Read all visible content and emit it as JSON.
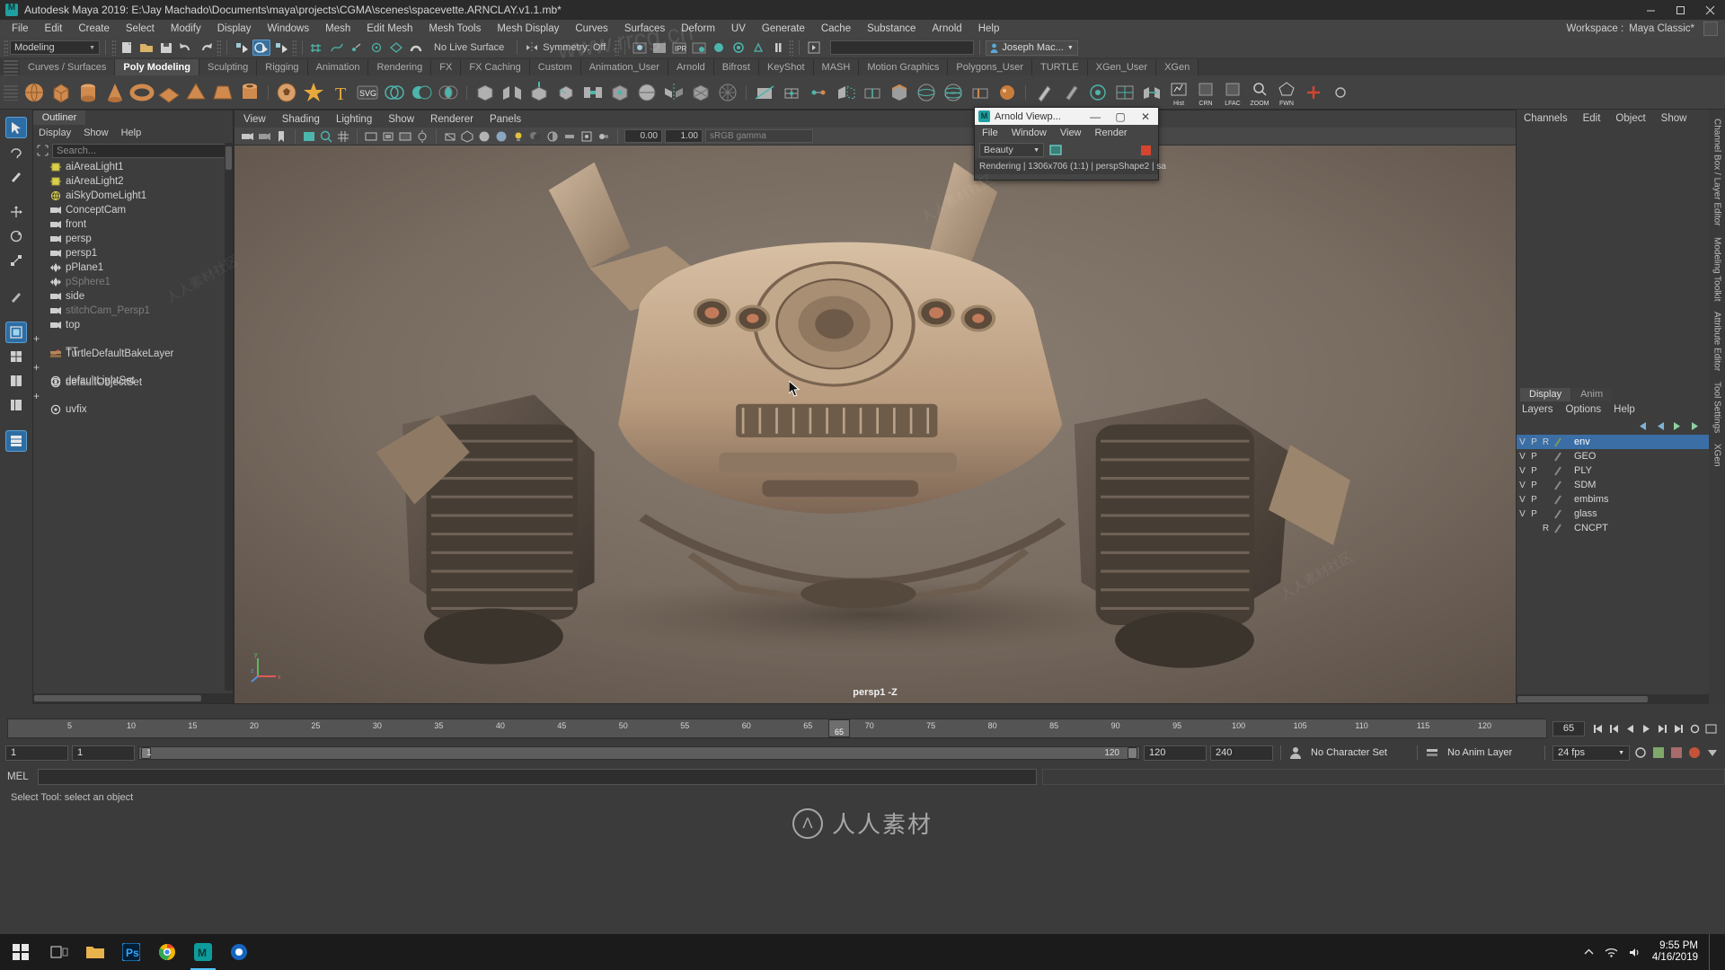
{
  "window": {
    "title": "Autodesk Maya 2019: E:\\Jay Machado\\Documents\\maya\\projects\\CGMA\\scenes\\spacevette.ARNCLAY.v1.1.mb*",
    "minimize": "—",
    "maximize": "▢",
    "close": "✕"
  },
  "menubar": {
    "items": [
      {
        "label": "File"
      },
      {
        "label": "Edit"
      },
      {
        "label": "Create"
      },
      {
        "label": "Select"
      },
      {
        "label": "Modify"
      },
      {
        "label": "Display"
      },
      {
        "label": "Windows"
      },
      {
        "label": "Mesh"
      },
      {
        "label": "Edit Mesh"
      },
      {
        "label": "Mesh Tools"
      },
      {
        "label": "Mesh Display"
      },
      {
        "label": "Curves"
      },
      {
        "label": "Surfaces"
      },
      {
        "label": "Deform"
      },
      {
        "label": "UV"
      },
      {
        "label": "Generate"
      },
      {
        "label": "Cache"
      },
      {
        "label": "Substance"
      },
      {
        "label": "Arnold"
      },
      {
        "label": "Help"
      }
    ],
    "workspace_label": "Workspace :",
    "workspace_value": "Maya Classic*"
  },
  "statusbar": {
    "menu_set": "Modeling",
    "live_surface": "No Live Surface",
    "symmetry": "Symmetry: Off",
    "search_value": "",
    "user": "Joseph Mac...",
    "arrow": "▼"
  },
  "shelf": {
    "tabs": [
      {
        "label": "Curves / Surfaces",
        "active": false
      },
      {
        "label": "Poly Modeling",
        "active": true
      },
      {
        "label": "Sculpting",
        "active": false
      },
      {
        "label": "Rigging",
        "active": false
      },
      {
        "label": "Animation",
        "active": false
      },
      {
        "label": "Rendering",
        "active": false
      },
      {
        "label": "FX",
        "active": false
      },
      {
        "label": "FX Caching",
        "active": false
      },
      {
        "label": "Custom",
        "active": false
      },
      {
        "label": "Animation_User",
        "active": false
      },
      {
        "label": "Arnold",
        "active": false
      },
      {
        "label": "Bifrost",
        "active": false
      },
      {
        "label": "KeyShot",
        "active": false
      },
      {
        "label": "MASH",
        "active": false
      },
      {
        "label": "Motion Graphics",
        "active": false
      },
      {
        "label": "Polygons_User",
        "active": false
      },
      {
        "label": "TURTLE",
        "active": false
      },
      {
        "label": "XGen_User",
        "active": false
      },
      {
        "label": "XGen",
        "active": false
      }
    ],
    "right_icon_labels": [
      "Hist",
      "CRN",
      "LFAC",
      "ZOOM",
      "FWN"
    ]
  },
  "outliner": {
    "tab": "Outliner",
    "menus": [
      "Display",
      "Show",
      "Help"
    ],
    "search_placeholder": "Search...",
    "items": [
      {
        "label": "aiAreaLight1",
        "icon": "area-light-icon",
        "dim": false,
        "expand": false
      },
      {
        "label": "aiAreaLight2",
        "icon": "area-light-icon",
        "dim": false,
        "expand": false
      },
      {
        "label": "aiSkyDomeLight1",
        "icon": "skydome-light-icon",
        "dim": false,
        "expand": false
      },
      {
        "label": "ConceptCam",
        "icon": "camera-icon",
        "dim": false,
        "expand": false
      },
      {
        "label": "front",
        "icon": "camera-icon",
        "dim": false,
        "expand": false
      },
      {
        "label": "persp",
        "icon": "camera-icon",
        "dim": false,
        "expand": false
      },
      {
        "label": "persp1",
        "icon": "camera-icon",
        "dim": false,
        "expand": false
      },
      {
        "label": "pPlane1",
        "icon": "mesh-icon",
        "dim": false,
        "expand": false
      },
      {
        "label": "pSphere1",
        "icon": "mesh-icon",
        "dim": true,
        "expand": false
      },
      {
        "label": "side",
        "icon": "camera-icon",
        "dim": false,
        "expand": false
      },
      {
        "label": "stitchCam_Persp1",
        "icon": "camera-icon",
        "dim": true,
        "expand": false
      },
      {
        "label": "top",
        "icon": "camera-icon",
        "dim": false,
        "expand": false
      },
      {
        "label": "TT",
        "icon": "turtle-icon",
        "dim": false,
        "expand": true
      },
      {
        "label": "TurtleDefaultBakeLayer",
        "icon": "bakelayer-icon",
        "dim": false,
        "expand": false
      },
      {
        "label": "defaultLightSet",
        "icon": "set-icon",
        "dim": false,
        "expand": true
      },
      {
        "label": "defaultObjectSet",
        "icon": "set-icon",
        "dim": false,
        "expand": false
      },
      {
        "label": "uvfix",
        "icon": "set-icon",
        "dim": false,
        "expand": true
      }
    ]
  },
  "viewport": {
    "menus": [
      "View",
      "Shading",
      "Lighting",
      "Show",
      "Renderer",
      "Panels"
    ],
    "exposure": "0.00",
    "gamma": "1.00",
    "color_space": "sRGB gamma",
    "camera_label": "persp1 -Z",
    "axis_x": "x",
    "axis_y": "y",
    "axis_z": "z"
  },
  "arnold_window": {
    "title": "Arnold Viewp...",
    "minimize": "—",
    "maximize": "▢",
    "close": "✕",
    "menus": [
      "File",
      "Window",
      "View",
      "Render"
    ],
    "aov": "Beauty",
    "status": "Rendering | 1306x706 (1:1) | perspShape2 | sa",
    "stop_color": "#d4452f"
  },
  "channelbox": {
    "menus": [
      "Channels",
      "Edit",
      "Object",
      "Show"
    ]
  },
  "layers": {
    "tabs": [
      {
        "label": "Display",
        "active": true
      },
      {
        "label": "Anim",
        "active": false
      }
    ],
    "menus": [
      "Layers",
      "Options",
      "Help"
    ],
    "columns": [
      "V",
      "P",
      "R"
    ],
    "rows": [
      {
        "v": "V",
        "p": "P",
        "r": "R",
        "name": "env",
        "color": "#7a9a5a",
        "selected": true
      },
      {
        "v": "V",
        "p": "P",
        "r": "",
        "name": "GEO",
        "color": "#8a8a8a",
        "selected": false
      },
      {
        "v": "V",
        "p": "P",
        "r": "",
        "name": "PLY",
        "color": "#8a8a8a",
        "selected": false
      },
      {
        "v": "V",
        "p": "P",
        "r": "",
        "name": "SDM",
        "color": "#8a8a8a",
        "selected": false
      },
      {
        "v": "V",
        "p": "P",
        "r": "",
        "name": "embims",
        "color": "#8a8a8a",
        "selected": false
      },
      {
        "v": "V",
        "p": "P",
        "r": "",
        "name": "glass",
        "color": "#8a8a8a",
        "selected": false
      },
      {
        "v": "",
        "p": "",
        "r": "R",
        "name": "CNCPT",
        "color": "#8a8a8a",
        "selected": false
      }
    ]
  },
  "right_vtabs": [
    "Channel Box / Layer Editor",
    "Modeling Toolkit",
    "Attribute Editor",
    "Tool Settings",
    "XGen"
  ],
  "timeslider": {
    "ticks": [
      "5",
      "10",
      "15",
      "20",
      "25",
      "30",
      "35",
      "40",
      "45",
      "50",
      "55",
      "60",
      "65",
      "70",
      "75",
      "80",
      "85",
      "90",
      "95",
      "100",
      "105",
      "110",
      "115",
      "120"
    ],
    "current_frame": "65",
    "current_field": "65",
    "buttons": [
      "⏮",
      "⏪",
      "◀",
      "⏸",
      "▶",
      "⏩",
      "⏭",
      "⏺"
    ]
  },
  "rangebar": {
    "start": "1",
    "anim_start": "1",
    "playback_start": "1",
    "playback_end": "120",
    "anim_end": "120",
    "end": "240",
    "character_set": "No Character Set",
    "anim_layer": "No Anim Layer",
    "fps": "24 fps",
    "arrow": "▼"
  },
  "cmdline": {
    "label": "MEL",
    "value": ""
  },
  "helpline": {
    "text": "Select Tool: select an object"
  },
  "watermark": {
    "brand": "人人素材",
    "mark": "Λ",
    "tiles": [
      "人人素材社区",
      "www.rrcg.cn",
      "人人素材社区",
      "人人素材社区"
    ]
  },
  "taskbar": {
    "start": "start-icon",
    "items": [
      "task-view-icon",
      "file-explorer-icon",
      "photoshop-icon",
      "chrome-icon",
      "maya-icon",
      "media-icon"
    ],
    "tray": [
      "chevron-up-icon",
      "network-icon",
      "volume-icon"
    ],
    "time": "9:55 PM",
    "date": "4/16/2019"
  },
  "colors": {
    "accent": "#3a6ea5",
    "panel_bg": "#3d3d3d",
    "toolbar_bg": "#434343",
    "viewport_bg": "#6b6057",
    "active_tab": "#4d4d4d",
    "stop_red": "#d4452f"
  }
}
